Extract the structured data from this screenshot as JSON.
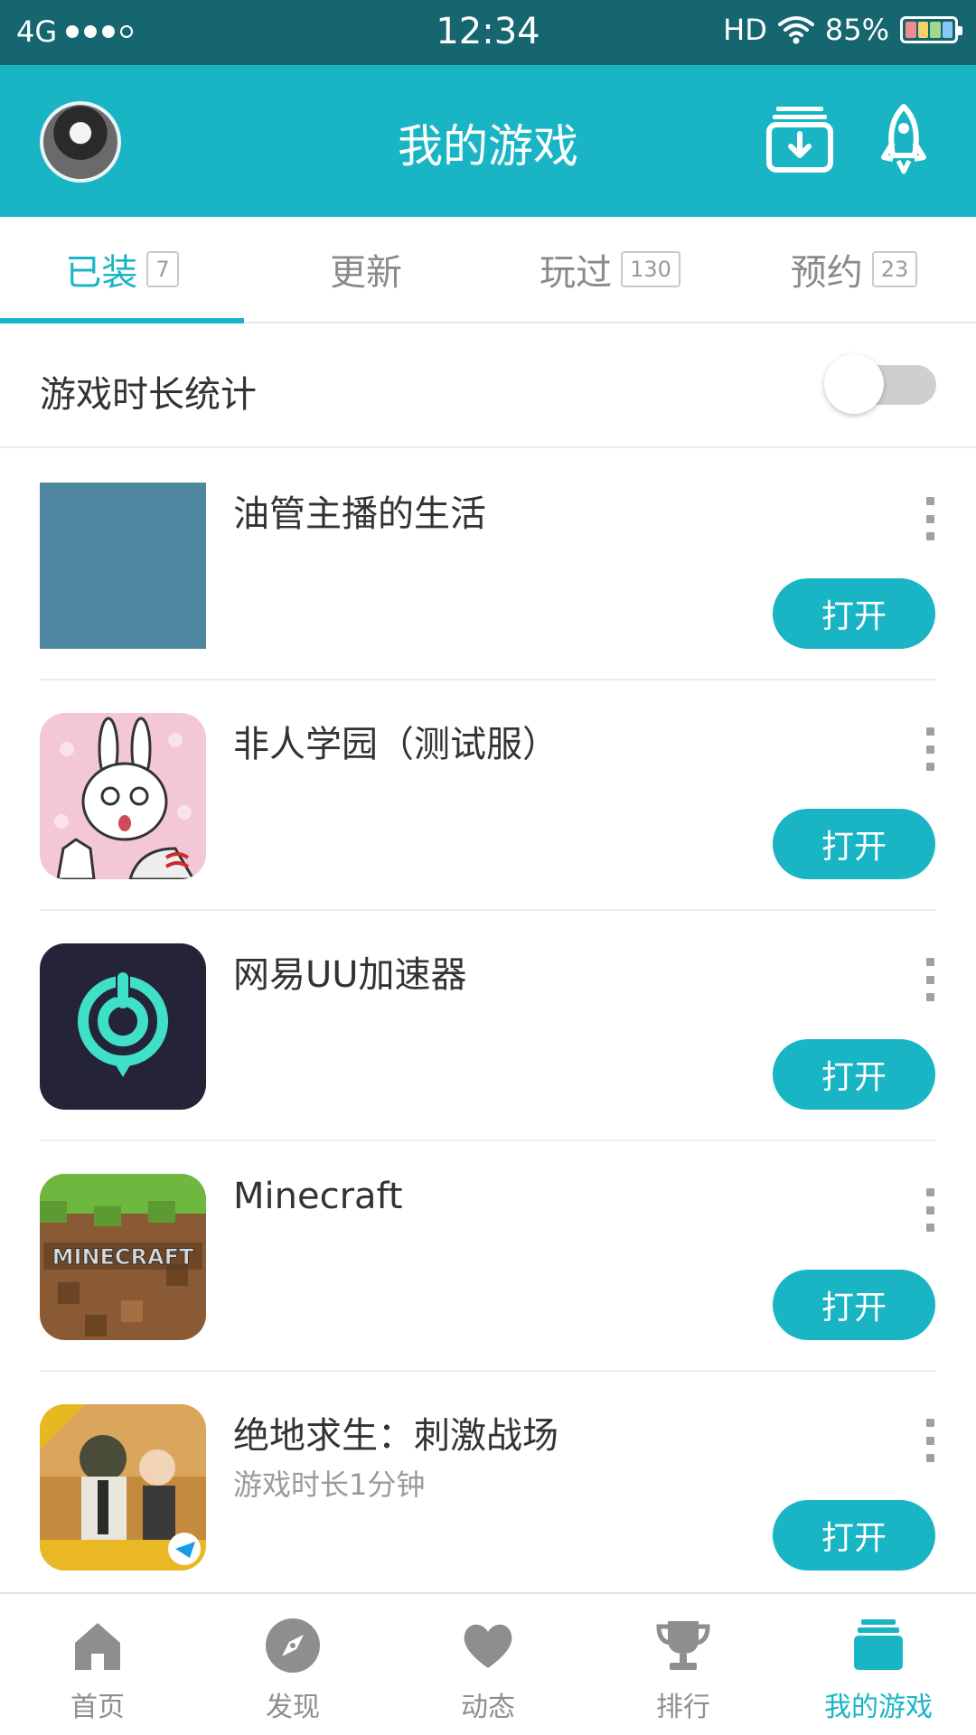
{
  "status_bar": {
    "network": "4G",
    "time": "12:34",
    "hd": "HD",
    "battery_text": "85%",
    "battery_percent": 85
  },
  "header": {
    "title": "我的游戏",
    "download_icon": "download-box-icon",
    "rocket_icon": "rocket-icon"
  },
  "tabs": [
    {
      "label": "已装",
      "badge": "7",
      "active": true
    },
    {
      "label": "更新",
      "badge": "",
      "active": false
    },
    {
      "label": "玩过",
      "badge": "130",
      "active": false
    },
    {
      "label": "预约",
      "badge": "23",
      "active": false
    }
  ],
  "stats": {
    "label": "游戏时长统计",
    "enabled": false
  },
  "games": [
    {
      "name": "油管主播的生活",
      "subtitle": "",
      "button": "打开",
      "icon_color": "#4f869f"
    },
    {
      "name": "非人学园（测试服）",
      "subtitle": "",
      "button": "打开",
      "icon_color": "#f3c7d6"
    },
    {
      "name": "网易UU加速器",
      "subtitle": "",
      "button": "打开",
      "icon_color": "#242338"
    },
    {
      "name": "Minecraft",
      "subtitle": "",
      "button": "打开",
      "icon_color": "#8a5a34"
    },
    {
      "name": "绝地求生：刺激战场",
      "subtitle": "游戏时长1分钟",
      "button": "打开",
      "icon_color": "#c48a3d"
    }
  ],
  "bottom_nav": [
    {
      "label": "首页",
      "icon": "home-icon",
      "active": false
    },
    {
      "label": "发现",
      "icon": "compass-icon",
      "active": false
    },
    {
      "label": "动态",
      "icon": "heart-icon",
      "active": false
    },
    {
      "label": "排行",
      "icon": "trophy-icon",
      "active": false
    },
    {
      "label": "我的游戏",
      "icon": "my-games-icon",
      "active": true
    }
  ],
  "colors": {
    "accent": "#1ab5c5",
    "status_bar": "#15666f"
  }
}
